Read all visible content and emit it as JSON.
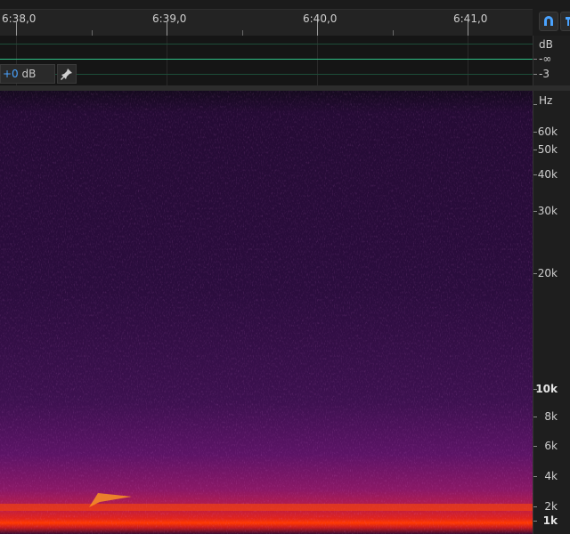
{
  "timeline": {
    "labels": [
      "6:38,0",
      "6:39,0",
      "6:40,0",
      "6:41,0"
    ]
  },
  "waveform": {
    "gain_sign": "+0",
    "gain_unit": "dB"
  },
  "amplitude_scale": {
    "unit": "dB",
    "labels": [
      "-∞",
      "-3"
    ]
  },
  "frequency_scale": {
    "unit": "Hz",
    "labels": [
      "60k",
      "50k",
      "40k",
      "30k",
      "20k",
      "10k",
      "8k",
      "6k",
      "4k",
      "2k",
      "1k"
    ]
  },
  "colors": {
    "spectrogram_low": "#2a0d3c",
    "spectrogram_mid": "#7a1670",
    "spectrogram_high": "#ff2a00",
    "accent": "#4aa3ff",
    "waveform": "#2fbf86"
  }
}
